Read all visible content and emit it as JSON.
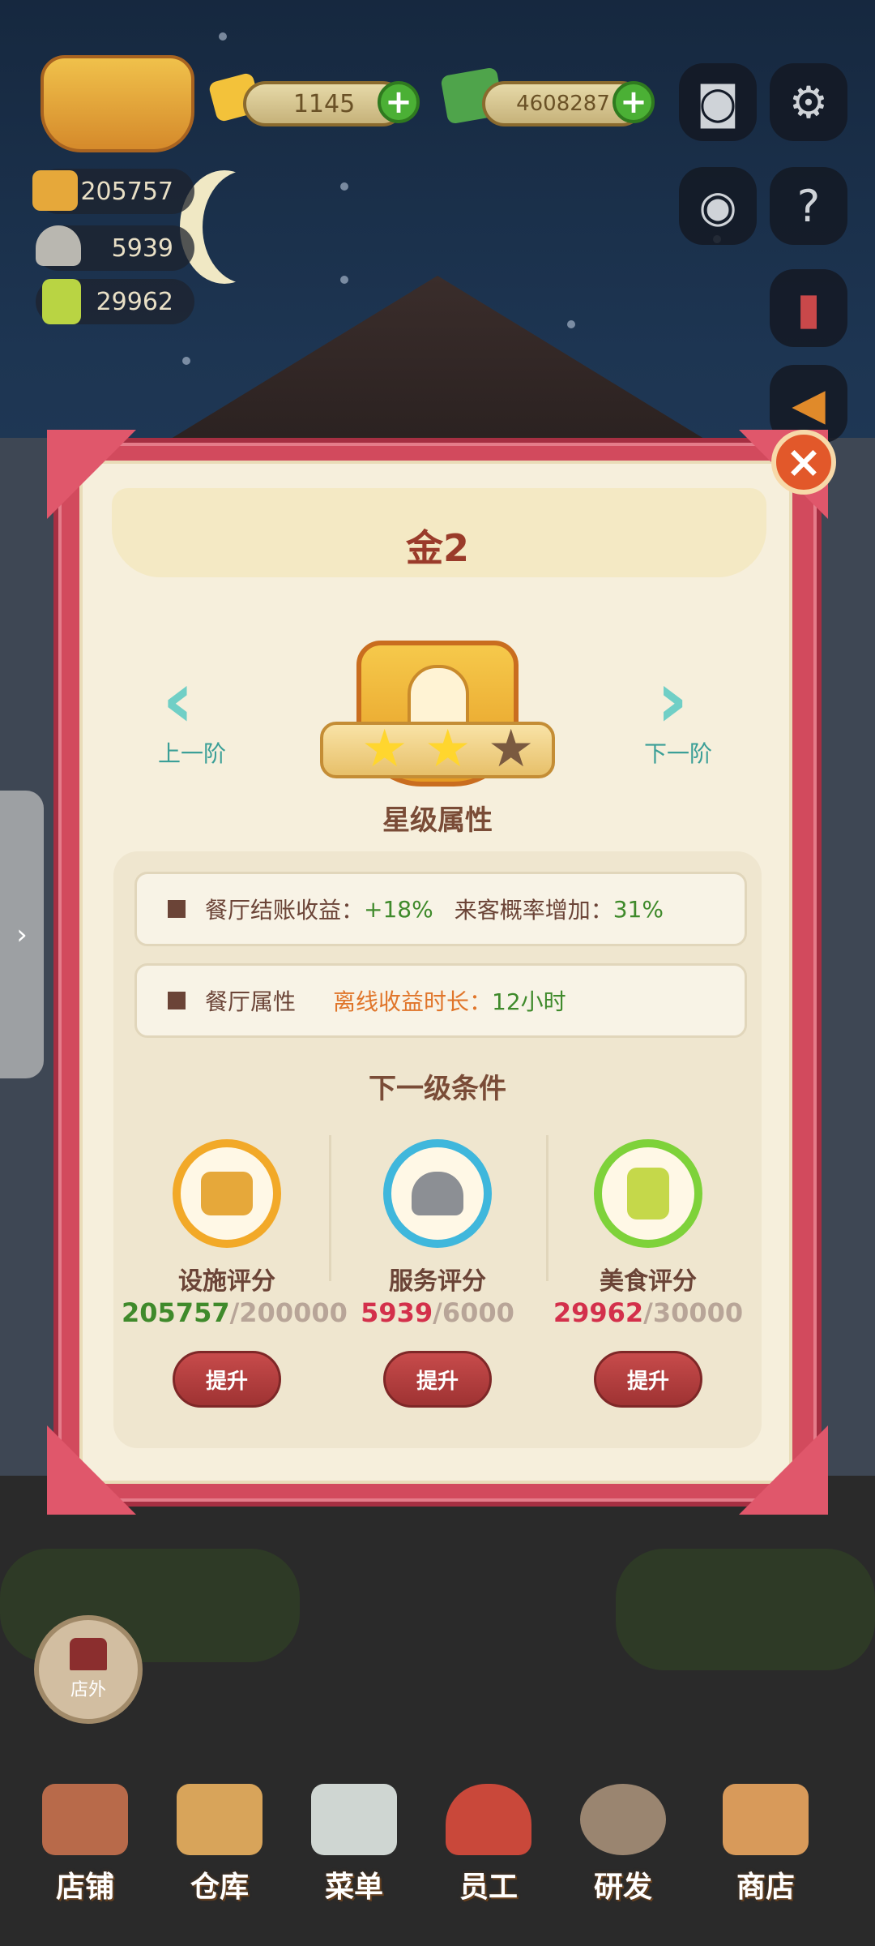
{
  "hud": {
    "gems": "1145",
    "cash": "4608287",
    "facility_score": "205757",
    "service_score": "5939",
    "food_score": "29962"
  },
  "modal": {
    "title": "金2",
    "prev_label": "上一阶",
    "next_label": "下一阶",
    "stars_filled": 2,
    "stars_total": 3,
    "section_title": "星级属性",
    "attrs": [
      {
        "label": "餐厅结账收益：",
        "value": "+18%",
        "label2": "来客概率增加：",
        "value2": "31%"
      },
      {
        "label": "餐厅属性",
        "label2": "离线收益时长：",
        "value2": "12小时"
      }
    ],
    "conditions_title": "下一级条件",
    "conditions": [
      {
        "name": "设施评分",
        "current": "205757",
        "required": "/200000",
        "button": "提升",
        "icon": "facility-icon",
        "ring_color": "#f2a928",
        "current_color": "#3f8a2b"
      },
      {
        "name": "服务评分",
        "current": "5939",
        "required": "/6000",
        "button": "提升",
        "icon": "service-icon",
        "ring_color": "#3fb7dc",
        "current_color": "#d3304b"
      },
      {
        "name": "美食评分",
        "current": "29962",
        "required": "/30000",
        "button": "提升",
        "icon": "food-book-icon",
        "ring_color": "#7ed23a",
        "current_color": "#d3304b"
      }
    ]
  },
  "outside_label": "店外",
  "bottom_nav": [
    {
      "label": "店铺",
      "icon": "shop-icon"
    },
    {
      "label": "仓库",
      "icon": "warehouse-icon"
    },
    {
      "label": "菜单",
      "icon": "menu-icon"
    },
    {
      "label": "员工",
      "icon": "staff-icon"
    },
    {
      "label": "研发",
      "icon": "research-icon"
    },
    {
      "label": "商店",
      "icon": "store-icon"
    }
  ],
  "colors": {
    "accent_red": "#d24a5d",
    "button_red": "#9f3333",
    "plus_green": "#4bb035"
  }
}
